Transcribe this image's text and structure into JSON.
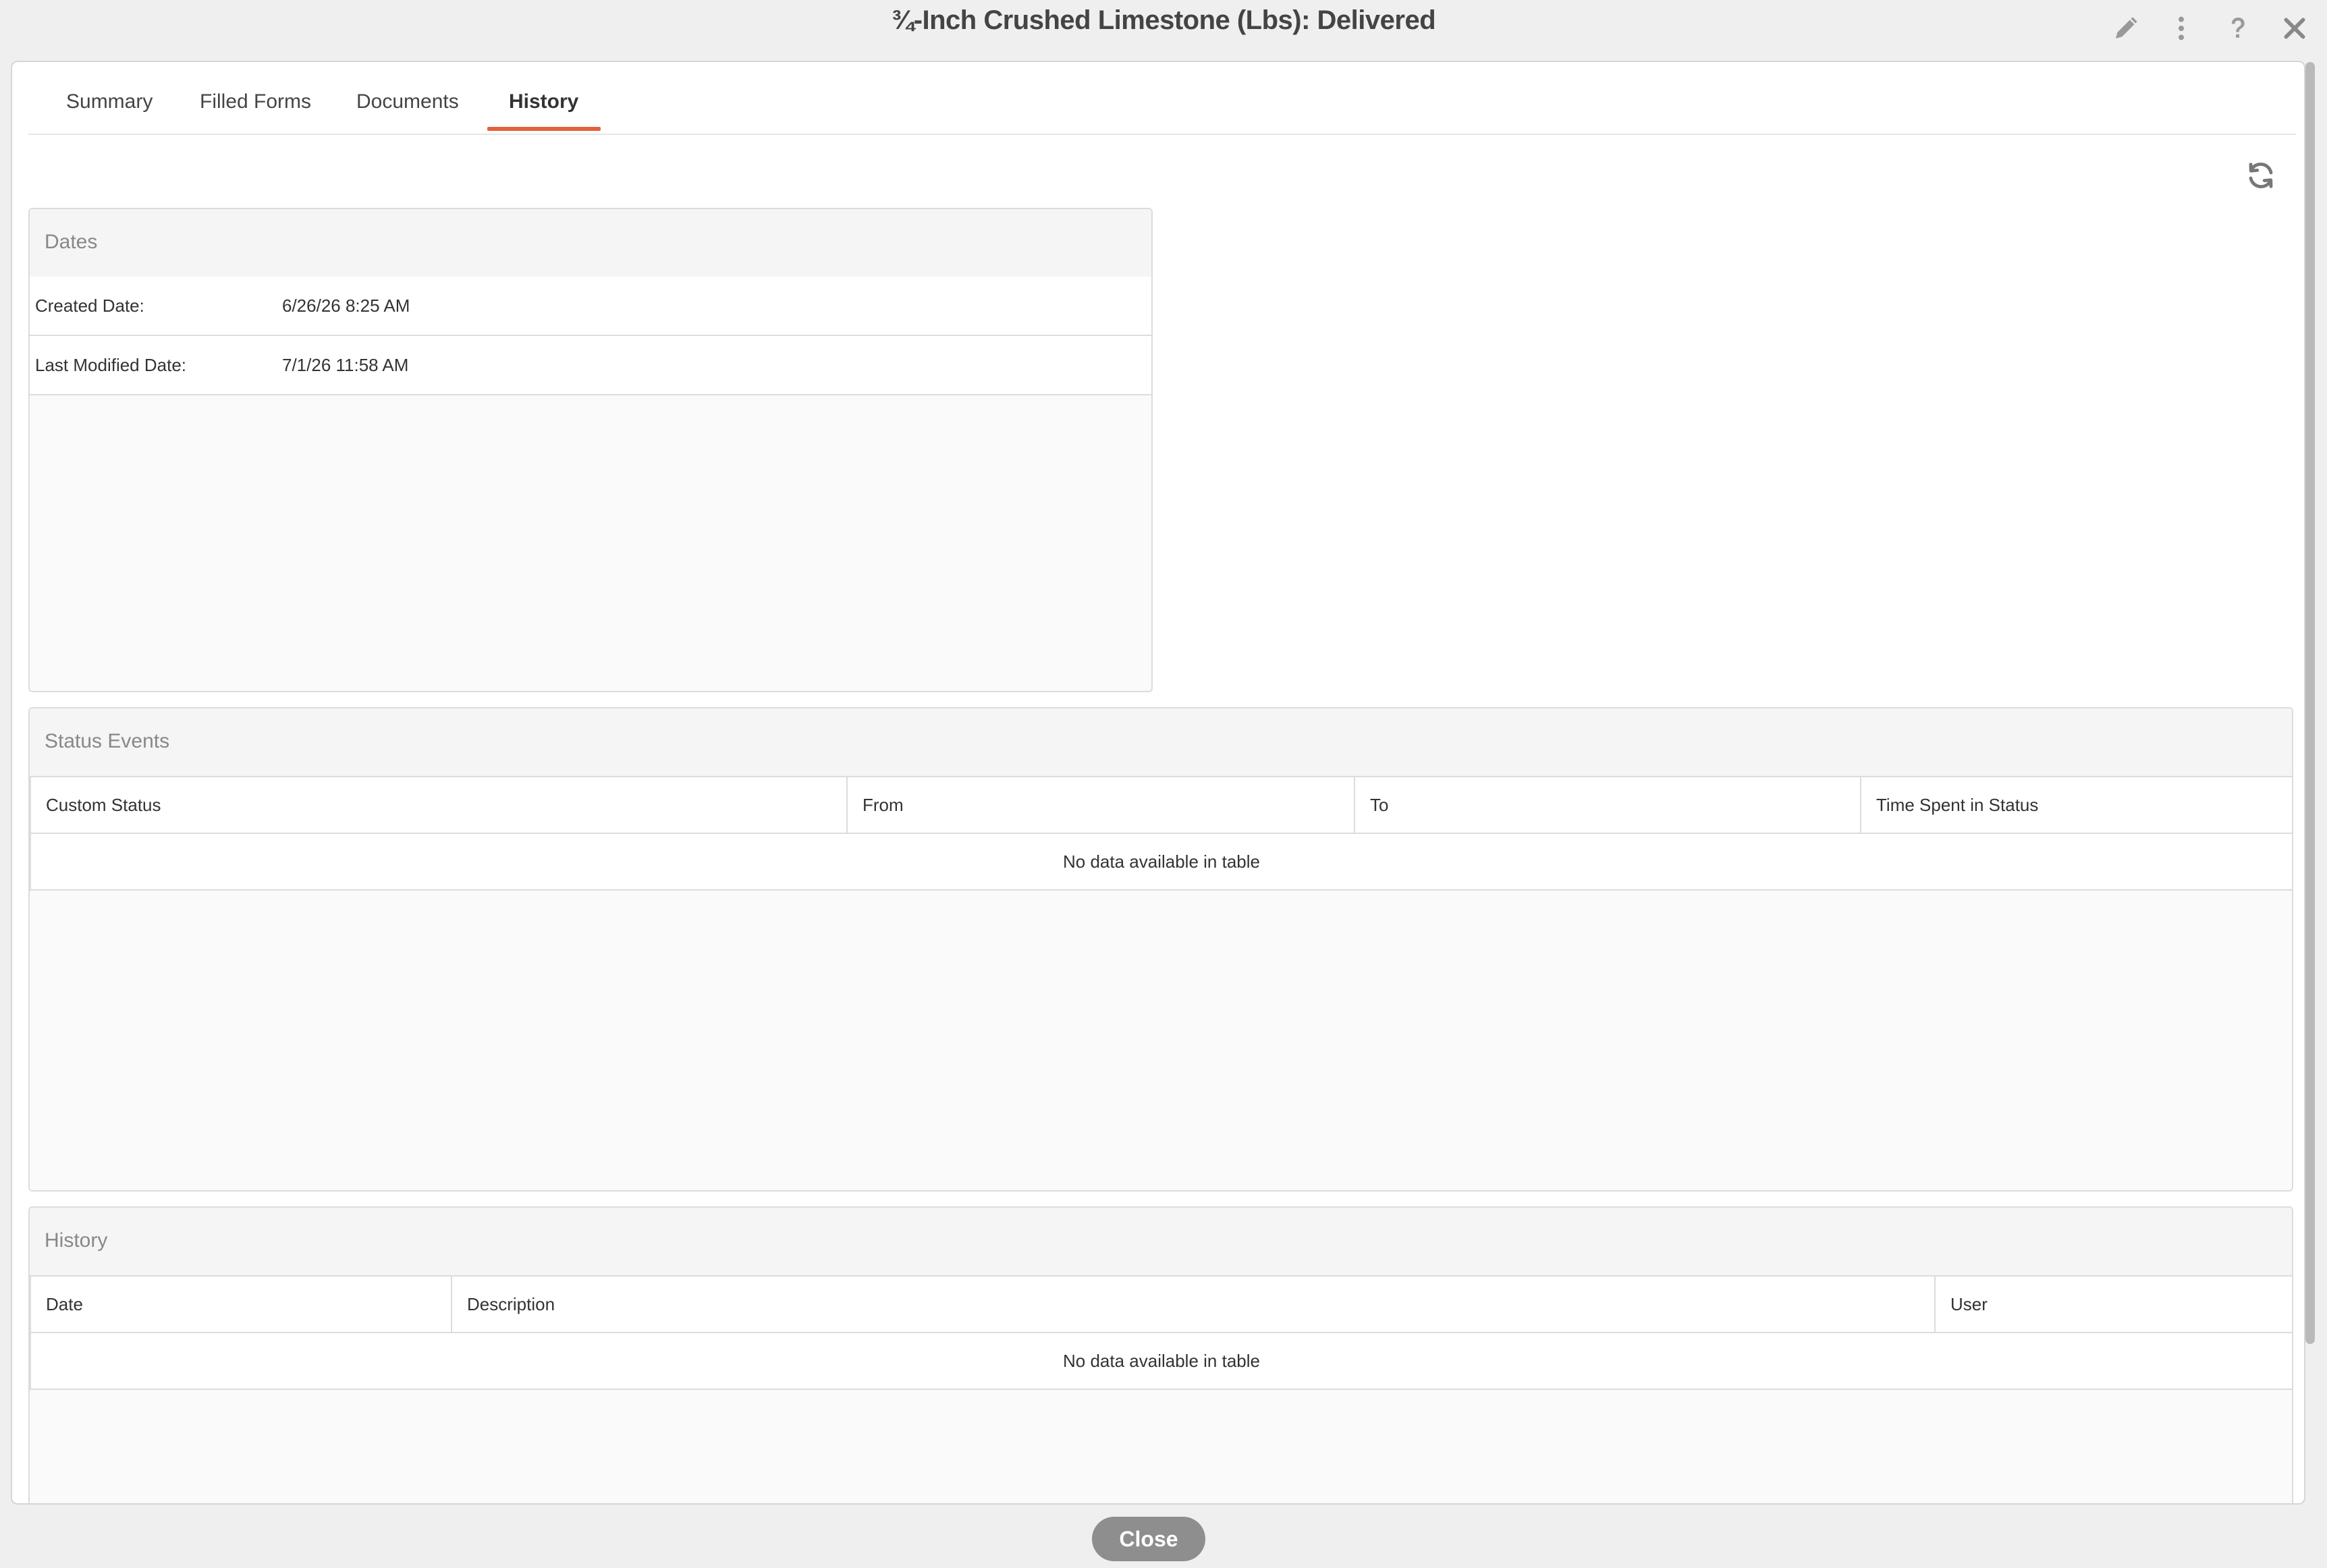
{
  "window": {
    "title": "¾-Inch Crushed Limestone (Lbs): Delivered",
    "edit_icon": "pencil-icon",
    "more_icon": "kebab-menu-icon",
    "help_icon": "question-mark-icon",
    "close_icon": "close-x-icon"
  },
  "tabs": [
    {
      "label": "Summary"
    },
    {
      "label": "Filled Forms"
    },
    {
      "label": "Documents"
    },
    {
      "label": "History",
      "active": true
    }
  ],
  "refresh_icon": "refresh-icon",
  "accent_color": "#e1623c",
  "dates_panel": {
    "title": "Dates",
    "rows": [
      {
        "label": "Created Date:",
        "value": "6/26/26 8:25 AM"
      },
      {
        "label": "Last Modified Date:",
        "value": "7/1/26 11:58 AM"
      }
    ]
  },
  "status_events": {
    "title": "Status Events",
    "columns": [
      "Custom Status",
      "From",
      "To",
      "Time Spent in Status"
    ],
    "empty_text": "No data available in table"
  },
  "history": {
    "title": "History",
    "columns": [
      "Date",
      "Description",
      "User"
    ],
    "empty_text": "No data available in table"
  },
  "footer": {
    "close_label": "Close"
  }
}
